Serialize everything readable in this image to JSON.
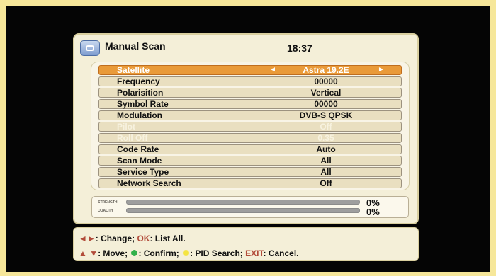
{
  "app": {
    "title": "Manual Scan",
    "time": "18:37"
  },
  "fields": [
    {
      "label": "Satellite",
      "value": "Astra 19.2E",
      "left_arrow": "◄",
      "right_arrow": "►",
      "selected": true,
      "disabled": false
    },
    {
      "label": "Frequency",
      "value": "00000",
      "selected": false,
      "disabled": false
    },
    {
      "label": "Polarisition",
      "value": "Vertical",
      "selected": false,
      "disabled": false
    },
    {
      "label": "Symbol Rate",
      "value": "00000",
      "selected": false,
      "disabled": false
    },
    {
      "label": "Modulation",
      "value": "DVB-S QPSK",
      "selected": false,
      "disabled": false
    },
    {
      "label": "Pilot",
      "value": "Off",
      "selected": false,
      "disabled": true
    },
    {
      "label": "Roll Off",
      "value": "0.35",
      "selected": false,
      "disabled": true
    },
    {
      "label": "Code Rate",
      "value": "Auto",
      "selected": false,
      "disabled": false
    },
    {
      "label": "Scan Mode",
      "value": "All",
      "selected": false,
      "disabled": false
    },
    {
      "label": "Service Type",
      "value": "All",
      "selected": false,
      "disabled": false
    },
    {
      "label": "Network Search",
      "value": "Off",
      "selected": false,
      "disabled": false
    }
  ],
  "signal": {
    "strength_label": "STRENGTH",
    "quality_label": "QUALITY",
    "strength_value": "0%",
    "quality_value": "0%",
    "strength_fraction": 0,
    "quality_fraction": 0
  },
  "help": {
    "line1_arrows": "◄►",
    "line1_change": ": Change; ",
    "line1_ok": "OK",
    "line1_list_all": ": List All.",
    "line2_arrows": "▲ ▼",
    "line2_move": ": Move; ",
    "line2_confirm": ": Confirm; ",
    "line2_pid": ": PID Search; ",
    "line2_exit": "EXIT",
    "line2_cancel": ": Cancel."
  },
  "colors": {
    "selection": "#e99a39",
    "panel": "#f4efd8",
    "accent_red": "#b24b3a",
    "green_key": "#32b14b",
    "yellow_key": "#f4e442"
  },
  "icons": {
    "menu": "satellite-tv-icon",
    "confirm": "green-dot-icon",
    "pid_search": "yellow-dot-icon"
  }
}
